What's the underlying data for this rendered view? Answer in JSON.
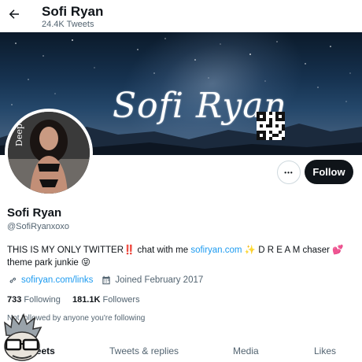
{
  "header": {
    "title": "Sofi Ryan",
    "tweet_count": "24.4K Tweets"
  },
  "banner": {
    "signature": "Sofi Ryan"
  },
  "avatar": {
    "side_text": "Deeper."
  },
  "actions": {
    "more_label": "•••",
    "follow_label": "Follow"
  },
  "profile": {
    "name": "Sofi Ryan",
    "handle": "@SofiRyanxoxo",
    "bio_part1": "THIS IS MY ONLY TWITTER",
    "bio_part2": " chat with me ",
    "bio_link": "sofiryan.com",
    "bio_part3": " D R E A M chaser ",
    "bio_part4": "theme park junkie ",
    "website": "sofiryan.com/links",
    "joined": "Joined February 2017"
  },
  "stats": {
    "following_count": "733",
    "following_label": "Following",
    "followers_count": "181.1K",
    "followers_label": "Followers"
  },
  "followed_note": "Not followed by anyone you're following",
  "tabs": [
    "Tweets",
    "Tweets & replies",
    "Media",
    "Likes"
  ],
  "icons": {
    "back": "arrow-left-icon",
    "link": "link-icon",
    "calendar": "calendar-icon",
    "more": "more-icon"
  },
  "colors": {
    "accent": "#1d9bf0",
    "text": "#0f1419",
    "muted": "#536471",
    "follow_bg": "#0f1419"
  }
}
